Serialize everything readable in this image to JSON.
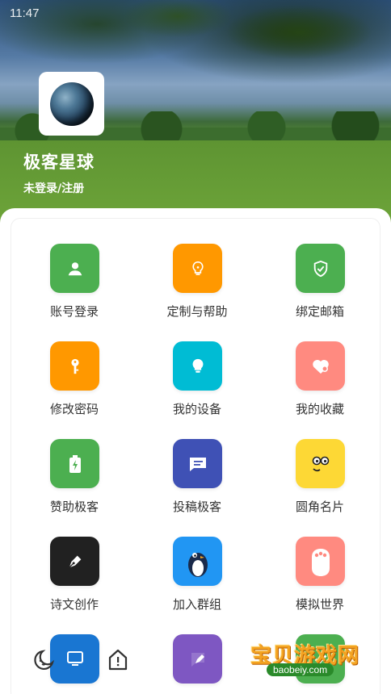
{
  "status_bar": {
    "time": "11:47"
  },
  "profile": {
    "app_name": "极客星球",
    "login_text": "未登录/注册"
  },
  "tiles": [
    {
      "label": "账号登录",
      "color": "#4caf50",
      "icon": "person-icon"
    },
    {
      "label": "定制与帮助",
      "color": "#ff9800",
      "icon": "lightbulb-icon"
    },
    {
      "label": "绑定邮箱",
      "color": "#4caf50",
      "icon": "shield-check-icon"
    },
    {
      "label": "修改密码",
      "color": "#ff9800",
      "icon": "key-icon"
    },
    {
      "label": "我的设备",
      "color": "#00bcd4",
      "icon": "bulb-device-icon"
    },
    {
      "label": "我的收藏",
      "color": "#ff8a80",
      "icon": "heart-icon"
    },
    {
      "label": "赞助极客",
      "color": "#4caf50",
      "icon": "battery-icon"
    },
    {
      "label": "投稿极客",
      "color": "#3f51b5",
      "icon": "message-icon"
    },
    {
      "label": "圆角名片",
      "color": "#fdd835",
      "icon": "face-icon"
    },
    {
      "label": "诗文创作",
      "color": "#212121",
      "icon": "pen-icon"
    },
    {
      "label": "加入群组",
      "color": "#2196f3",
      "icon": "penguin-icon"
    },
    {
      "label": "模拟世界",
      "color": "#ff8a80",
      "icon": "paw-icon"
    },
    {
      "label": "",
      "color": "#1976d2",
      "icon": "desktop-icon"
    },
    {
      "label": "",
      "color": "#7e57c2",
      "icon": "edit-icon"
    },
    {
      "label": "",
      "color": "#4caf50",
      "icon": "check-icon"
    }
  ],
  "bottom_nav": [
    {
      "icon": "moon-icon"
    },
    {
      "icon": "info-icon"
    }
  ],
  "watermark": {
    "text": "宝贝游戏网",
    "url": "baobeiy.com"
  }
}
